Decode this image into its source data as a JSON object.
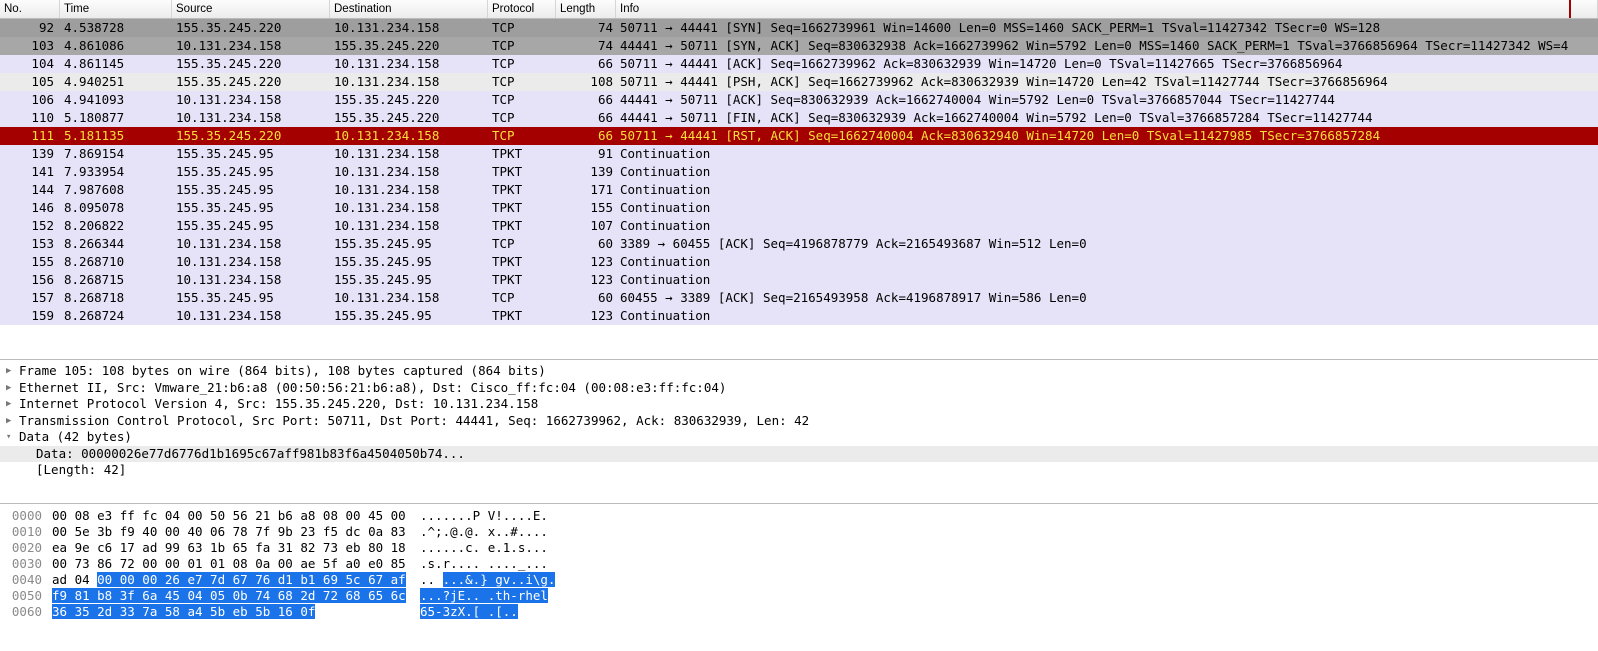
{
  "columns": {
    "no": "No.",
    "time": "Time",
    "source": "Source",
    "destination": "Destination",
    "protocol": "Protocol",
    "length": "Length",
    "info": "Info"
  },
  "packets": [
    {
      "no": "92",
      "time": "4.538728",
      "src": "155.35.245.220",
      "dst": "10.131.234.158",
      "proto": "TCP",
      "len": "74",
      "info": "50711 → 44441 [SYN] Seq=1662739961 Win=14600 Len=0 MSS=1460 SACK_PERM=1 TSval=11427342 TSecr=0 WS=128",
      "cls": "bg0"
    },
    {
      "no": "103",
      "time": "4.861086",
      "src": "10.131.234.158",
      "dst": "155.35.245.220",
      "proto": "TCP",
      "len": "74",
      "info": "44441 → 50711 [SYN, ACK] Seq=830632938 Ack=1662739962 Win=5792 Len=0 MSS=1460 SACK_PERM=1 TSval=3766856964 TSecr=11427342 WS=4",
      "cls": "bg1"
    },
    {
      "no": "104",
      "time": "4.861145",
      "src": "155.35.245.220",
      "dst": "10.131.234.158",
      "proto": "TCP",
      "len": "66",
      "info": "50711 → 44441 [ACK] Seq=1662739962 Ack=830632939 Win=14720 Len=0 TSval=11427665 TSecr=3766856964",
      "cls": "bg2"
    },
    {
      "no": "105",
      "time": "4.940251",
      "src": "155.35.245.220",
      "dst": "10.131.234.158",
      "proto": "TCP",
      "len": "108",
      "info": "50711 → 44441 [PSH, ACK] Seq=1662739962 Ack=830632939 Win=14720 Len=42 TSval=11427744 TSecr=3766856964",
      "cls": "sel"
    },
    {
      "no": "106",
      "time": "4.941093",
      "src": "10.131.234.158",
      "dst": "155.35.245.220",
      "proto": "TCP",
      "len": "66",
      "info": "44441 → 50711 [ACK] Seq=830632939 Ack=1662740004 Win=5792 Len=0 TSval=3766857044 TSecr=11427744",
      "cls": "bg4"
    },
    {
      "no": "110",
      "time": "5.180877",
      "src": "10.131.234.158",
      "dst": "155.35.245.220",
      "proto": "TCP",
      "len": "66",
      "info": "44441 → 50711 [FIN, ACK] Seq=830632939 Ack=1662740004 Win=5792 Len=0 TSval=3766857284 TSecr=11427744",
      "cls": "bg5"
    },
    {
      "no": "111",
      "time": "5.181135",
      "src": "155.35.245.220",
      "dst": "10.131.234.158",
      "proto": "TCP",
      "len": "66",
      "info": "50711 → 44441 [RST, ACK] Seq=1662740004 Ack=830632940 Win=14720 Len=0 TSval=11427985 TSecr=3766857284",
      "cls": "bg6",
      "mark": true
    },
    {
      "no": "139",
      "time": "7.869154",
      "src": "155.35.245.95",
      "dst": "10.131.234.158",
      "proto": "TPKT",
      "len": "91",
      "info": "Continuation",
      "cls": "bg7"
    },
    {
      "no": "141",
      "time": "7.933954",
      "src": "155.35.245.95",
      "dst": "10.131.234.158",
      "proto": "TPKT",
      "len": "139",
      "info": "Continuation",
      "cls": "bg7"
    },
    {
      "no": "144",
      "time": "7.987608",
      "src": "155.35.245.95",
      "dst": "10.131.234.158",
      "proto": "TPKT",
      "len": "171",
      "info": "Continuation",
      "cls": "bg7"
    },
    {
      "no": "146",
      "time": "8.095078",
      "src": "155.35.245.95",
      "dst": "10.131.234.158",
      "proto": "TPKT",
      "len": "155",
      "info": "Continuation",
      "cls": "bg7"
    },
    {
      "no": "152",
      "time": "8.206822",
      "src": "155.35.245.95",
      "dst": "10.131.234.158",
      "proto": "TPKT",
      "len": "107",
      "info": "Continuation",
      "cls": "bg7"
    },
    {
      "no": "153",
      "time": "8.266344",
      "src": "10.131.234.158",
      "dst": "155.35.245.95",
      "proto": "TCP",
      "len": "60",
      "info": "3389 → 60455 [ACK] Seq=4196878779 Ack=2165493687 Win=512 Len=0",
      "cls": "bg2"
    },
    {
      "no": "155",
      "time": "8.268710",
      "src": "10.131.234.158",
      "dst": "155.35.245.95",
      "proto": "TPKT",
      "len": "123",
      "info": "Continuation",
      "cls": "bg7"
    },
    {
      "no": "156",
      "time": "8.268715",
      "src": "10.131.234.158",
      "dst": "155.35.245.95",
      "proto": "TPKT",
      "len": "123",
      "info": "Continuation",
      "cls": "bg7"
    },
    {
      "no": "157",
      "time": "8.268718",
      "src": "155.35.245.95",
      "dst": "10.131.234.158",
      "proto": "TCP",
      "len": "60",
      "info": "60455 → 3389 [ACK] Seq=2165493958 Ack=4196878917 Win=586 Len=0",
      "cls": "bg2"
    },
    {
      "no": "159",
      "time": "8.268724",
      "src": "10.131.234.158",
      "dst": "155.35.245.95",
      "proto": "TPKT",
      "len": "123",
      "info": "Continuation",
      "cls": "bg7"
    }
  ],
  "tree": {
    "l0": "Frame 105: 108 bytes on wire (864 bits), 108 bytes captured (864 bits)",
    "l1": "Ethernet II, Src: Vmware_21:b6:a8 (00:50:56:21:b6:a8), Dst: Cisco_ff:fc:04 (00:08:e3:ff:fc:04)",
    "l2": "Internet Protocol Version 4, Src: 155.35.245.220, Dst: 10.131.234.158",
    "l3": "Transmission Control Protocol, Src Port: 50711, Dst Port: 44441, Seq: 1662739962, Ack: 830632939, Len: 42",
    "l4": "Data (42 bytes)",
    "l5": "Data: 00000026e77d6776d1b1695c67aff981b83f6a4504050b74...",
    "l6": "[Length: 42]"
  },
  "hex": [
    {
      "off": "0000",
      "b": "00 08 e3 ff fc 04 00 50  56 21 b6 a8 08 00 45 00",
      "a": ".......P V!....E.",
      "hlb": "",
      "hla": ""
    },
    {
      "off": "0010",
      "b": "00 5e 3b f9 40 00 40 06  78 7f 9b 23 f5 dc 0a 83",
      "a": ".^;.@.@. x..#....",
      "hlb": "",
      "hla": ""
    },
    {
      "off": "0020",
      "b": "ea 9e c6 17 ad 99 63 1b  65 fa 31 82 73 eb 80 18",
      "a": "......c. e.1.s...",
      "hlb": "",
      "hla": ""
    },
    {
      "off": "0030",
      "b": "00 73 86 72 00 00 01 01  08 0a 00 ae 5f a0 e0 85",
      "a": ".s.r.... ...._...",
      "hlb": "",
      "hla": ""
    },
    {
      "off": "0040",
      "b": "ad 04 ",
      "bhl": "00 00 00 26 e7 7d  67 76 d1 b1 69 5c 67 af",
      "a": ".. ",
      "ahl": "...&.} gv..i\\g."
    },
    {
      "off": "0050",
      "b": "",
      "bhl": "f9 81 b8 3f 6a 45 04 05  0b 74 68 2d 72 68 65 6c",
      "a": "",
      "ahl": "...?jE.. .th-rhel"
    },
    {
      "off": "0060",
      "b": "",
      "bhl": "36 35 2d 33 7a 58 a4 5b  eb 5b 16 0f",
      "a": "",
      "ahl": "65-3zX.[ .[.."
    }
  ]
}
